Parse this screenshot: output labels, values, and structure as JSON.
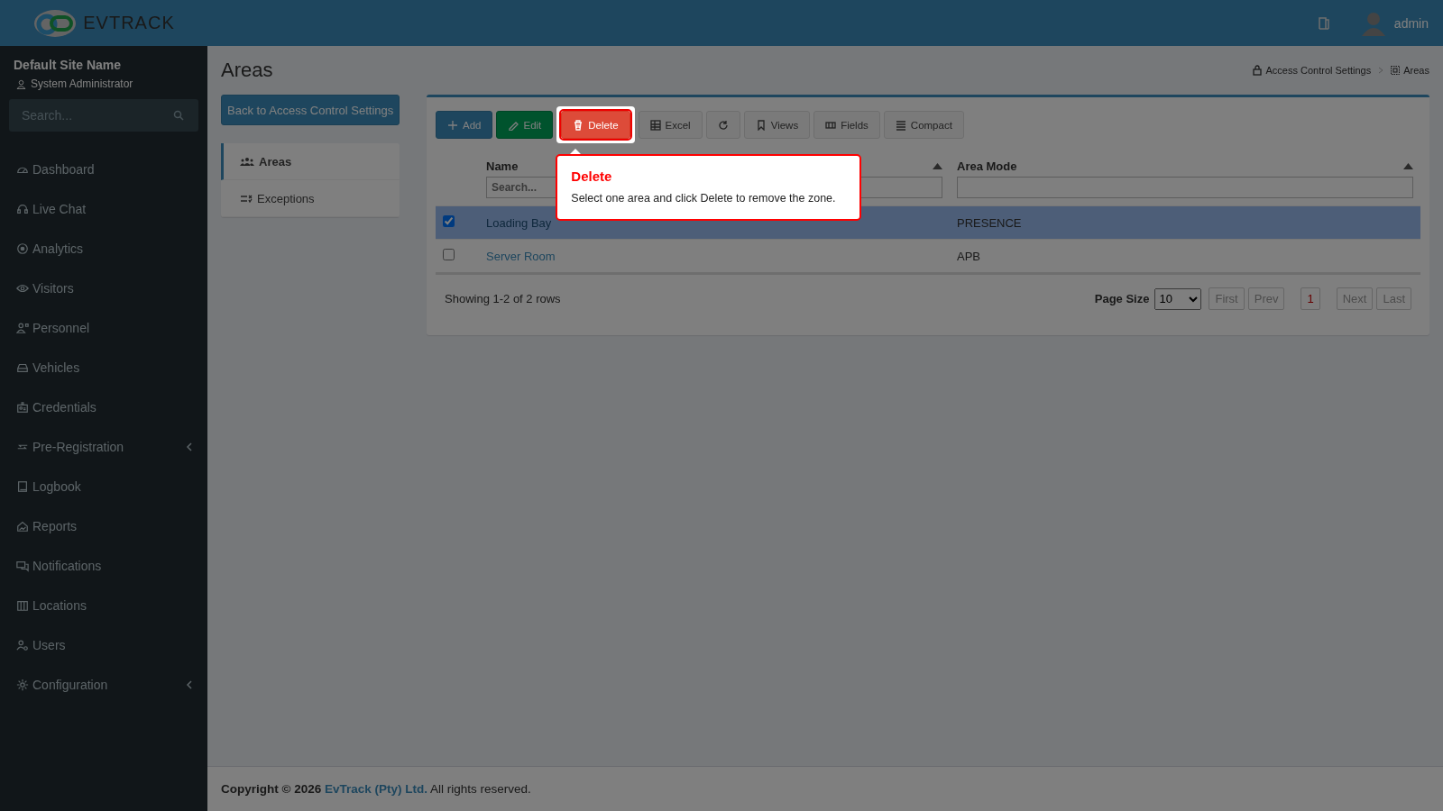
{
  "header": {
    "logo": "**EV**TRACK",
    "user": "admin"
  },
  "sidebar": {
    "site_name": "Default Site Name",
    "role": "System Administrator",
    "search": {
      "placeholder": "Search..."
    },
    "items": [
      {
        "label": "Dashboard",
        "submenu": false
      },
      {
        "label": "Live Chat",
        "submenu": false
      },
      {
        "label": "Analytics",
        "submenu": false
      },
      {
        "label": "Visitors",
        "submenu": false
      },
      {
        "label": "Personnel",
        "submenu": false
      },
      {
        "label": "Vehicles",
        "submenu": false
      },
      {
        "label": "Credentials",
        "submenu": false
      },
      {
        "label": "Pre-Registration",
        "submenu": true
      },
      {
        "label": "Logbook",
        "submenu": false
      },
      {
        "label": "Reports",
        "submenu": false
      },
      {
        "label": "Notifications",
        "submenu": false
      },
      {
        "label": "Locations",
        "submenu": false
      },
      {
        "label": "Users",
        "submenu": false
      },
      {
        "label": "Configuration",
        "submenu": true
      }
    ]
  },
  "page": {
    "title": "Areas",
    "breadcrumbs": [
      "Access Control Settings",
      "Areas"
    ],
    "back_button": "Back to Access Control Settings",
    "subnav": [
      {
        "label": "Areas",
        "selected": true
      },
      {
        "label": "Exceptions",
        "selected": false
      }
    ]
  },
  "toolbar": [
    {
      "label": "Add",
      "kind": "primary",
      "highlighted": false
    },
    {
      "label": "Edit",
      "kind": "success",
      "highlighted": false
    },
    {
      "label": "Delete",
      "kind": "danger",
      "highlighted": true
    },
    {
      "label": "Excel",
      "kind": "default",
      "highlighted": false
    },
    {
      "kind": "default",
      "highlighted": false
    },
    {
      "label": "Views",
      "kind": "default",
      "highlighted": false
    },
    {
      "label": "Fields",
      "kind": "default",
      "highlighted": false
    },
    {
      "label": "Compact",
      "kind": "default",
      "highlighted": false
    }
  ],
  "tour_tip": {
    "title": "Delete",
    "text": "Select one area and click Delete to remove the zone."
  },
  "table": {
    "columns": [
      {
        "label": "Name",
        "filter_placeholder": "Search..."
      },
      {
        "label": "Area Mode"
      }
    ],
    "rows": [
      {
        "name": "Loading Bay",
        "area_mode": "PRESENCE",
        "selected": true
      },
      {
        "name": "Server Room",
        "area_mode": "APB",
        "selected": false
      }
    ],
    "summary": "Showing 1-2 of 2 rows",
    "page_size_label": "Page Size",
    "page_size": "10",
    "pager": [
      {
        "label": "First",
        "selected": false,
        "disabled": true
      },
      {
        "label": "Prev",
        "selected": false,
        "disabled": true
      },
      {
        "label": "1",
        "selected": true,
        "disabled": false
      },
      {
        "label": "Next",
        "selected": false,
        "disabled": true
      },
      {
        "label": "Last",
        "selected": false,
        "disabled": true
      }
    ]
  },
  "footer": {
    "prefix": "Copyright © 2026",
    "link": "EvTrack (Pty) Ltd.",
    "suffix": "All rights reserved."
  }
}
